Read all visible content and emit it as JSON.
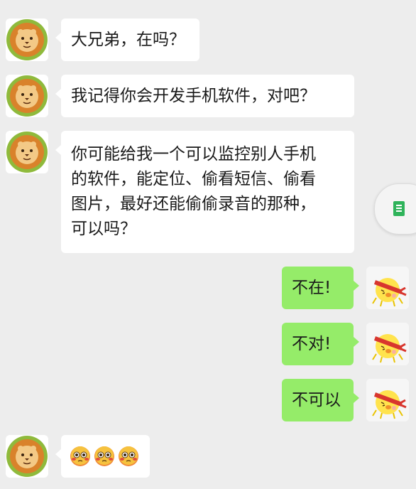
{
  "messages": [
    {
      "side": "in",
      "text": "大兄弟，在吗？"
    },
    {
      "side": "in",
      "text": "我记得你会开发手机软件，对吧？"
    },
    {
      "side": "in",
      "lines": [
        "你可能给我一个可以监控别人手机",
        "的软件，能定位、偷看短信、偷看",
        "图片，最好还能偷偷录音的那种，",
        "可以吗？"
      ]
    },
    {
      "side": "out",
      "text": "不在!"
    },
    {
      "side": "out",
      "text": "不对!"
    },
    {
      "side": "out",
      "text": "不可以"
    },
    {
      "side": "in",
      "emojis": [
        "flushed-face-emoji",
        "flushed-face-emoji",
        "flushed-face-emoji"
      ]
    }
  ],
  "avatars": {
    "contact": "lion-avatar",
    "self": "chick-headband-avatar"
  },
  "floating_button": {
    "icon": "document-icon"
  },
  "colors": {
    "background": "#ededed",
    "incoming_bubble": "#ffffff",
    "outgoing_bubble": "#95ec69"
  }
}
